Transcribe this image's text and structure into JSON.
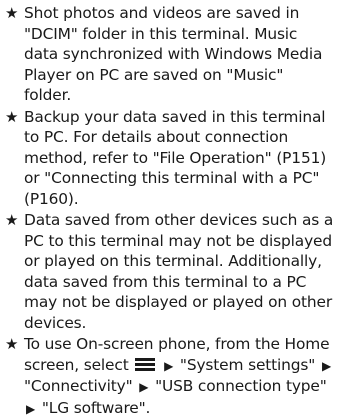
{
  "bullet_icon": "star-icon",
  "notes": [
    {
      "text": "Shot photos and videos are saved in \"DCIM\" folder in this terminal. Music data synchronized with Windows Media Player on PC are saved on \"Music\" folder."
    },
    {
      "text": "Backup your data saved in this terminal to PC. For details about connection method, refer to \"File Operation\" (P151) or \"Connecting this terminal with a PC\" (P160)."
    },
    {
      "text": "Data saved from other devices such as a PC to this terminal may not be displayed or played on this terminal. Additionally, data saved from this terminal to a PC may not be displayed or played on other devices."
    }
  ],
  "last_note": {
    "intro": "To use On-screen phone, from the Home screen, select",
    "menu_icon": "menu-icon",
    "arrow_icon": "right-triangle-icon",
    "steps": [
      "\"System settings\"",
      "\"Connectivity\"",
      "\"USB connection type\"",
      "\"LG software\"."
    ]
  }
}
